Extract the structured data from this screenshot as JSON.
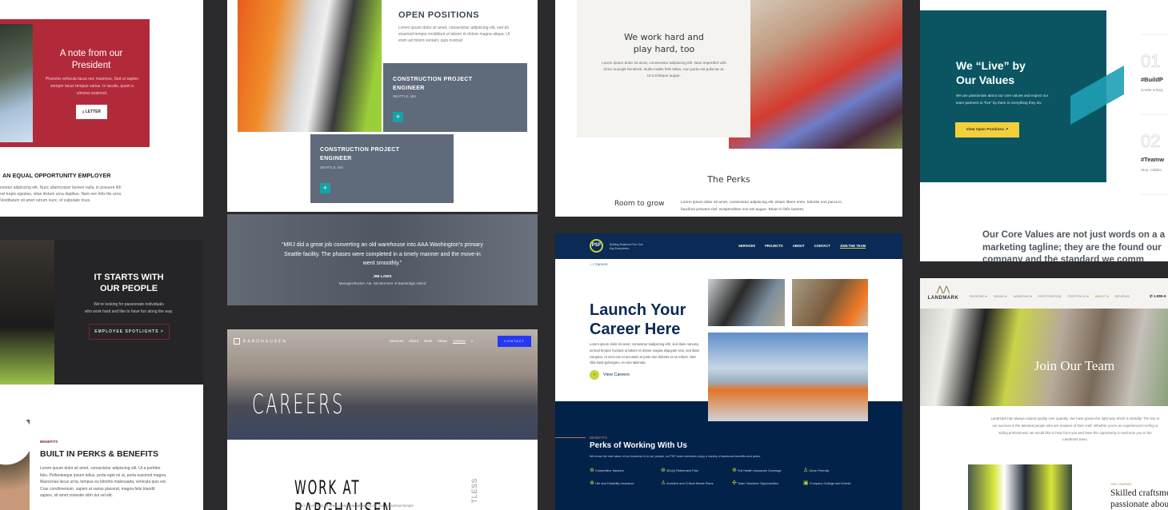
{
  "panel_president": {
    "heading": "A note from our President",
    "body": "Pharetra vehicula lacus nec maximus. Sed ut sapien semper lacus tempus varius. In iaculis, quam a ultricies euismod.",
    "button": "LETTER",
    "section_title": "AN EQUAL OPPORTUNITY EMPLOYER",
    "section_body": "ectetur adipiscing elit. Nunc ullamcorper laoreet nulla, in posuere ibh vel turpis egestas, vitae dictum urna dapibus. Nam nec felis ttis urna. Vestibulum sit amet rutrum nunc, et vulputate risus.",
    "accent": "#b22a3a"
  },
  "panel_people": {
    "heading_line1": "IT STARTS WITH",
    "heading_line2": "OUR PEOPLE",
    "body_line1": "We're looking for passionate individuals",
    "body_line2": "who work hard and like to have fun along the way.",
    "button": "EMPLOYEE SPOTLIGHTS >",
    "eyebrow": "BENEFITS",
    "benefits_title": "BUILT IN PERKS & BENEFITS",
    "benefits_body": "Lorem ipsum dolor sit amet, consectetur adipiscing elit. Ut a porttitor felis. Pellentesque ipsum tellus, porta eget mi ut, porta euismod magna. Maecenas lacus urna, tempus eu lobortis malesuada, vehicula quis est. Cras condimentum, sapien at varius placerat, magna felis blandit sapien, sit amet molestie nibh dui vel elit."
  },
  "panel_positions": {
    "heading": "OPEN POSITIONS",
    "body": "Lorem ipsum dolor sit amet, consectetur adipiscing elit, sed do eiusmod tempor incididunt ut labore et dolore magna aliqua. Ut enim ad minim veniam, quis nostrud",
    "jobs": [
      {
        "title": "CONSTRUCTION PROJECT ENGINEER",
        "location": "SEATTLE, WA",
        "button": "+"
      },
      {
        "title": "CONSTRUCTION PROJECT ENGINEER",
        "location": "SEATTLE, WA",
        "button": "+"
      }
    ]
  },
  "panel_testimonial": {
    "quote": "“MRJ did a great job converting an old warehouse into AAA Washington’s primary Seattle facility. The phases were completed in a timely manner and the move-in went smoothly.”",
    "author": "JIM LAWS",
    "role": "Manager/Broker, Ala. Windermere of Bainbridge Island"
  },
  "panel_barghausen": {
    "logo": "BARGHAUSEN",
    "nav": [
      "Services",
      "About",
      "Work",
      "News",
      "Careers"
    ],
    "contact": "CONTACT",
    "hero": "CAREERS",
    "title": "WORK AT BARGHAUSEN",
    "body": "Lorem ipsum dolor sit amet, consectetur adipiscing elit, sed do eiusmod tempor",
    "side_text": "TLESS",
    "accent": "#2438f5"
  },
  "panel_perks": {
    "heading": "We work hard and play hard, too",
    "body": "Lorem ipsum dolor sit amet, consectetur adipiscing elit. Nam imperdiet velit id leo suscipit hendrerit. Nulla mattis felis tellus, non porta est pulvinar at. Ut a tristique augue.",
    "perks_title": "The Perks",
    "perk_name": "Room to grow",
    "perk_body": "Lorem ipsum dolor sit amet, consectetur adipiscing elit. Etiam libero enim, lobortis non purus in, faucibus posuere nisl. Suspendisse non est augue. Etiam in felis laoreet,"
  },
  "panel_psf": {
    "logo": "PSF",
    "tagline": "Building Relations First. One Day Everywhere.",
    "nav": [
      "SERVICES",
      "PROJECTS",
      "ABOUT",
      "CONTACT",
      "JOIN THE TEAM"
    ],
    "breadcrumb": "Careers",
    "heading_line1": "Launch Your",
    "heading_line2": "Career Here",
    "body": "Lorem ipsum dolor sit amet, consetetur sadipscing elitr, sed diam nonumy eirmod tempor invidunt ut labore et dolore magna aliquyam erat, sed diam voluptua. At vero eos et accusam et justo duo dolores et ea rebum. Stet clita kasd gubergren, no sea takimata.",
    "cta": "View Careers",
    "eyebrow": "BENEFITS",
    "perks_title": "Perks of Working With Us",
    "perks_body": "We know the real value of our business is in our people, so PSF team members enjoy a variety of awesome benefits and perks.",
    "benefits": [
      {
        "label": "Competitive Salaries",
        "icon": "dollar-icon"
      },
      {
        "label": "401(k) Retirement Plan",
        "icon": "piggy-bank-icon"
      },
      {
        "label": "Full Health Insurance Coverage",
        "icon": "health-icon"
      },
      {
        "label": "Union Friendly",
        "icon": "worker-icon"
      },
      {
        "label": "Life and Disability Insurance",
        "icon": "shield-icon"
      },
      {
        "label": "Accident and Critical Illness Plans",
        "icon": "bandage-icon"
      },
      {
        "label": "Team Volunteer Opportunities",
        "icon": "hands-icon"
      },
      {
        "label": "Company Outings and Events",
        "icon": "calendar-icon"
      }
    ],
    "navy": "#03224a",
    "accent": "#c8d43a"
  },
  "panel_values": {
    "heading_line1": "We “Live” by",
    "heading_line2": "Our Values",
    "body": "We are passionate about our core values and expect our team partners to “live” by them in everything they do.",
    "button": "View Open Positions ↗",
    "values": [
      {
        "num": "01",
        "tag": "#BuildP",
        "desc": "Create unforg"
      },
      {
        "num": "02",
        "tag": "#Teamw",
        "desc": "Stop, collabo"
      }
    ],
    "statement": "Our Core Values are not just words on a a marketing tagline; they are the found our company and the standard we comm",
    "teal": "#0b5562",
    "yellow": "#f2d03b"
  },
  "panel_landmark": {
    "logo": "LANDMARK",
    "nav": [
      "ROOFING ▾",
      "SIDING ▾",
      "WINDOWS ▾",
      "RESTORATION",
      "PORTFOLIO ▾",
      "ABOUT ▾",
      "REVIEWS"
    ],
    "phone": "1-855-9",
    "hero": "Join Our Team",
    "body": "Landmark has always valued quality over quantity. We have grown the right way which is steadily. The key to our success is the talented people who are masters of their craft. Whether you're an experienced roofing or siding professional, we would like to hear from you and have the opportunity to welcome you to the Landmark team.",
    "eyebrow": "OUR COMPANY",
    "subheading": "Skilled craftsmen passionate about quality work"
  }
}
